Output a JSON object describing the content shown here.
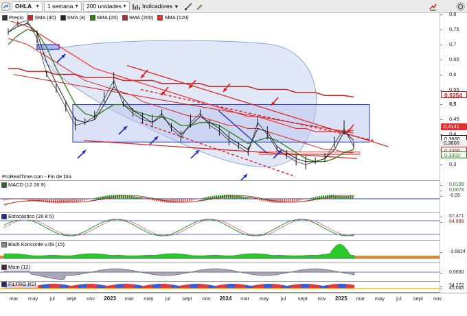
{
  "toolbar": {
    "symbol": "OHLA",
    "timeframe": "1 semana",
    "units": "200 unidades",
    "indicators_label": "Indicadores"
  },
  "legend": [
    {
      "label": "Precio",
      "color": "#333333"
    },
    {
      "label": "SMA (40)",
      "color": "#e02020"
    },
    {
      "label": "SMA (4)",
      "color": "#222222"
    },
    {
      "label": "SMA (20)",
      "color": "#2e7d1a"
    },
    {
      "label": "SMA (200)",
      "color": "#b03030"
    },
    {
      "label": "SMA (120)",
      "color": "#ff2a2a"
    }
  ],
  "source_label": "ProRealTime.com - Fin de Día",
  "y_axis": {
    "ticks": [
      "0,8",
      "0,75",
      "0,7",
      "0,65",
      "0,6",
      "0,55",
      "0,5",
      "0,45",
      "0,4",
      "0,35",
      "0,3"
    ],
    "tags": [
      {
        "value": "0,5254",
        "bg": "#ffffff",
        "fg": "#c02020"
      },
      {
        "value": "0,4141",
        "bg": "#e03030",
        "fg": "#ffffff"
      },
      {
        "value": "0,3660",
        "bg": "#ffffff",
        "fg": "#000000"
      },
      {
        "value": "0,3600",
        "bg": "#f0f0f0",
        "fg": "#000000"
      },
      {
        "value": "0,3366",
        "bg": "#ffffff",
        "fg": "#c02020"
      },
      {
        "value": "0,3302",
        "bg": "#ffffff",
        "fg": "#1a7a1a"
      }
    ]
  },
  "indicators": [
    {
      "title": "MACD (12 26 9)",
      "color": "#2a6a2a",
      "axis": [
        "0,0139",
        "0,0074",
        "-0,05"
      ]
    },
    {
      "title": "Estocástico (26 8 5)",
      "color": "#2a2a8a",
      "axis": [
        "67,471",
        "64,689"
      ]
    },
    {
      "title": "Blai5 Koncorde v.09 (15)",
      "color": "#4a4a4a",
      "axis": [
        "-3,6824"
      ]
    },
    {
      "title": "Mom (12)",
      "color": "#4a2a2a",
      "axis": [
        "0,0680"
      ]
    },
    {
      "title": "FILTRO RSI",
      "color": "#2a2a6a",
      "axis": [
        "54,272",
        "45,045"
      ]
    }
  ],
  "x_axis": {
    "labels": [
      {
        "text": "mar",
        "year": false
      },
      {
        "text": "may",
        "year": false
      },
      {
        "text": "jul",
        "year": false
      },
      {
        "text": "sept",
        "year": false
      },
      {
        "text": "nov",
        "year": false
      },
      {
        "text": "2023",
        "year": true
      },
      {
        "text": "mar",
        "year": false
      },
      {
        "text": "may",
        "year": false
      },
      {
        "text": "jul",
        "year": false
      },
      {
        "text": "sept",
        "year": false
      },
      {
        "text": "nov",
        "year": false
      },
      {
        "text": "2024",
        "year": true
      },
      {
        "text": "mar",
        "year": false
      },
      {
        "text": "may",
        "year": false
      },
      {
        "text": "jul",
        "year": false
      },
      {
        "text": "sept",
        "year": false
      },
      {
        "text": "nov",
        "year": false
      },
      {
        "text": "2025",
        "year": true
      },
      {
        "text": "mar",
        "year": false
      },
      {
        "text": "may",
        "year": false
      },
      {
        "text": "jul",
        "year": false
      },
      {
        "text": "sept",
        "year": false
      },
      {
        "text": "nov",
        "year": false
      }
    ]
  },
  "chart_data": {
    "type": "line",
    "title": "",
    "xlabel": "",
    "ylabel": "",
    "ylim": [
      0.25,
      0.8
    ],
    "legend_placement": "top-left",
    "grid": false,
    "x": [
      "2022-03",
      "2022-04",
      "2022-05",
      "2022-06",
      "2022-07",
      "2022-08",
      "2022-09",
      "2022-10",
      "2022-11",
      "2022-12",
      "2023-01",
      "2023-02",
      "2023-03",
      "2023-04",
      "2023-05",
      "2023-06",
      "2023-07",
      "2023-08",
      "2023-09",
      "2023-10",
      "2023-11",
      "2023-12",
      "2024-01",
      "2024-02",
      "2024-03",
      "2024-04",
      "2024-05",
      "2024-06",
      "2024-07",
      "2024-08",
      "2024-09",
      "2024-10",
      "2024-11",
      "2024-12",
      "2025-01",
      "2025-02",
      "2025-03"
    ],
    "series": [
      {
        "name": "Precio",
        "values": [
          0.74,
          0.77,
          0.78,
          0.72,
          0.6,
          0.55,
          0.49,
          0.43,
          0.44,
          0.46,
          0.52,
          0.58,
          0.5,
          0.47,
          0.45,
          0.44,
          0.47,
          0.42,
          0.39,
          0.44,
          0.47,
          0.43,
          0.41,
          0.38,
          0.36,
          0.34,
          0.44,
          0.4,
          0.35,
          0.33,
          0.31,
          0.3,
          0.31,
          0.32,
          0.37,
          0.42,
          0.36
        ]
      },
      {
        "name": "SMA (40)",
        "values": [
          0.72,
          0.71,
          0.7,
          0.68,
          0.66,
          0.64,
          0.62,
          0.6,
          0.58,
          0.57,
          0.56,
          0.55,
          0.54,
          0.53,
          0.51,
          0.5,
          0.49,
          0.48,
          0.47,
          0.46,
          0.46,
          0.45,
          0.44,
          0.43,
          0.43,
          0.42,
          0.42,
          0.41,
          0.4,
          0.39,
          0.38,
          0.37,
          0.36,
          0.35,
          0.35,
          0.34,
          0.34
        ]
      },
      {
        "name": "SMA (4)",
        "values": [
          0.74,
          0.76,
          0.77,
          0.74,
          0.64,
          0.57,
          0.51,
          0.45,
          0.44,
          0.45,
          0.5,
          0.56,
          0.52,
          0.48,
          0.46,
          0.44,
          0.46,
          0.43,
          0.4,
          0.43,
          0.46,
          0.44,
          0.42,
          0.39,
          0.37,
          0.35,
          0.42,
          0.41,
          0.36,
          0.34,
          0.32,
          0.31,
          0.31,
          0.32,
          0.35,
          0.41,
          0.38
        ]
      },
      {
        "name": "SMA (20)",
        "values": [
          0.7,
          0.73,
          0.75,
          0.74,
          0.69,
          0.62,
          0.56,
          0.5,
          0.47,
          0.46,
          0.48,
          0.5,
          0.5,
          0.48,
          0.47,
          0.46,
          0.46,
          0.45,
          0.43,
          0.43,
          0.44,
          0.44,
          0.43,
          0.41,
          0.39,
          0.37,
          0.38,
          0.39,
          0.38,
          0.36,
          0.34,
          0.32,
          0.31,
          0.31,
          0.32,
          0.34,
          0.35
        ]
      },
      {
        "name": "SMA (200)",
        "values": [
          0.62,
          0.62,
          0.61,
          0.61,
          0.61,
          0.6,
          0.6,
          0.6,
          0.59,
          0.59,
          0.59,
          0.59,
          0.58,
          0.58,
          0.58,
          0.58,
          0.57,
          0.57,
          0.57,
          0.57,
          0.57,
          0.56,
          0.56,
          0.56,
          0.56,
          0.56,
          0.55,
          0.55,
          0.55,
          0.55,
          0.54,
          0.54,
          0.54,
          0.53,
          0.53,
          0.53,
          0.525
        ]
      },
      {
        "name": "SMA (120)",
        "values": [
          0.78,
          0.77,
          0.76,
          0.74,
          0.72,
          0.7,
          0.68,
          0.66,
          0.64,
          0.62,
          0.61,
          0.6,
          0.59,
          0.58,
          0.57,
          0.56,
          0.55,
          0.54,
          0.53,
          0.52,
          0.51,
          0.5,
          0.49,
          0.48,
          0.47,
          0.46,
          0.46,
          0.45,
          0.44,
          0.43,
          0.42,
          0.42,
          0.41,
          0.41,
          0.41,
          0.41,
          0.414
        ]
      }
    ],
    "last_values": {
      "SMA (200)": 0.5254,
      "SMA (120)": 0.4141,
      "high": 0.366,
      "close": 0.36,
      "SMA (40)": 0.3366,
      "SMA (20)": 0.3302
    }
  }
}
